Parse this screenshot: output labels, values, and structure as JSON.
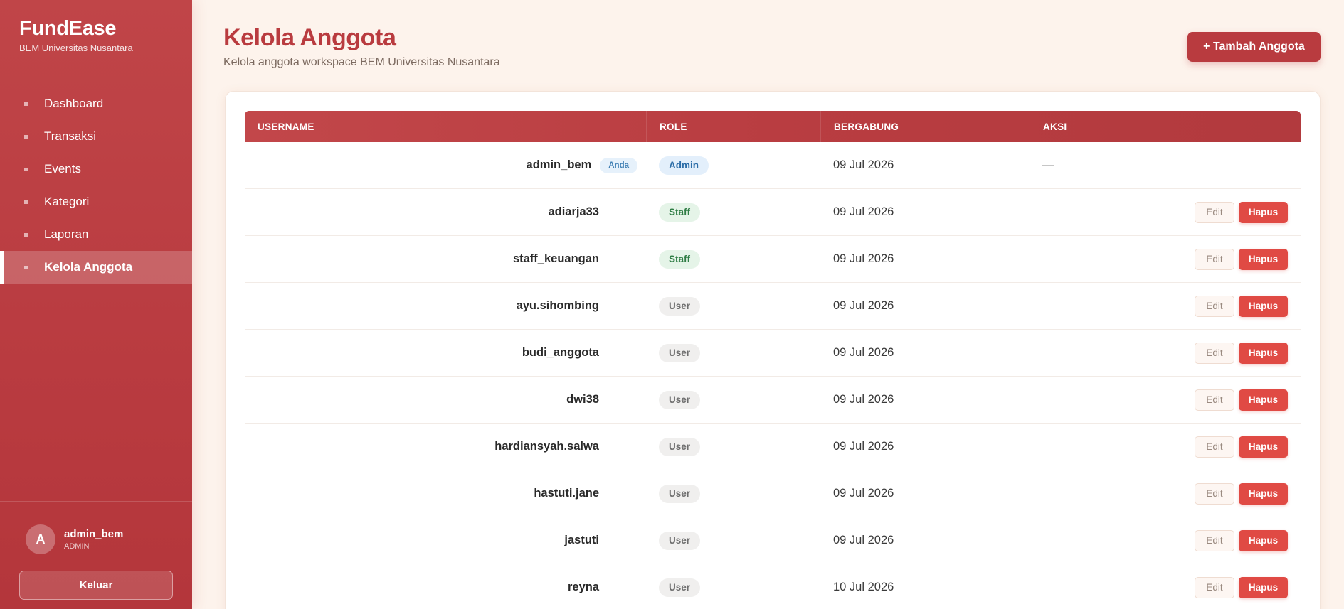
{
  "sidebar": {
    "brand_title": "FundEase",
    "brand_subtitle": "BEM Universitas Nusantara",
    "items": [
      {
        "label": "Dashboard",
        "active": false
      },
      {
        "label": "Transaksi",
        "active": false
      },
      {
        "label": "Events",
        "active": false
      },
      {
        "label": "Kategori",
        "active": false
      },
      {
        "label": "Laporan",
        "active": false
      },
      {
        "label": "Kelola Anggota",
        "active": true
      }
    ],
    "user": {
      "avatar_initial": "A",
      "name": "admin_bem",
      "role": "ADMIN"
    },
    "logout_label": "Keluar"
  },
  "header": {
    "title": "Kelola Anggota",
    "subtitle": "Kelola anggota workspace BEM Universitas Nusantara",
    "add_button_label": "+ Tambah Anggota"
  },
  "table": {
    "columns": {
      "username": "USERNAME",
      "role": "ROLE",
      "joined": "BERGABUNG",
      "actions": "AKSI"
    },
    "you_badge": "Anda",
    "no_action": "—",
    "edit_label": "Edit",
    "delete_label": "Hapus",
    "rows": [
      {
        "username": "admin_bem",
        "role": "Admin",
        "joined": "09 Jul 2026"
      },
      {
        "username": "adiarja33",
        "role": "Staff",
        "joined": "09 Jul 2026"
      },
      {
        "username": "staff_keuangan",
        "role": "Staff",
        "joined": "09 Jul 2026"
      },
      {
        "username": "ayu.sihombing",
        "role": "User",
        "joined": "09 Jul 2026"
      },
      {
        "username": "budi_anggota",
        "role": "User",
        "joined": "09 Jul 2026"
      },
      {
        "username": "dwi38",
        "role": "User",
        "joined": "09 Jul 2026"
      },
      {
        "username": "hardiansyah.salwa",
        "role": "User",
        "joined": "09 Jul 2026"
      },
      {
        "username": "hastuti.jane",
        "role": "User",
        "joined": "09 Jul 2026"
      },
      {
        "username": "jastuti",
        "role": "User",
        "joined": "09 Jul 2026"
      },
      {
        "username": "reyna",
        "role": "User",
        "joined": "10 Jul 2026"
      }
    ]
  },
  "colors": {
    "accent": "#b93b3f",
    "danger": "#e04a44",
    "background": "#fdf3ec"
  }
}
